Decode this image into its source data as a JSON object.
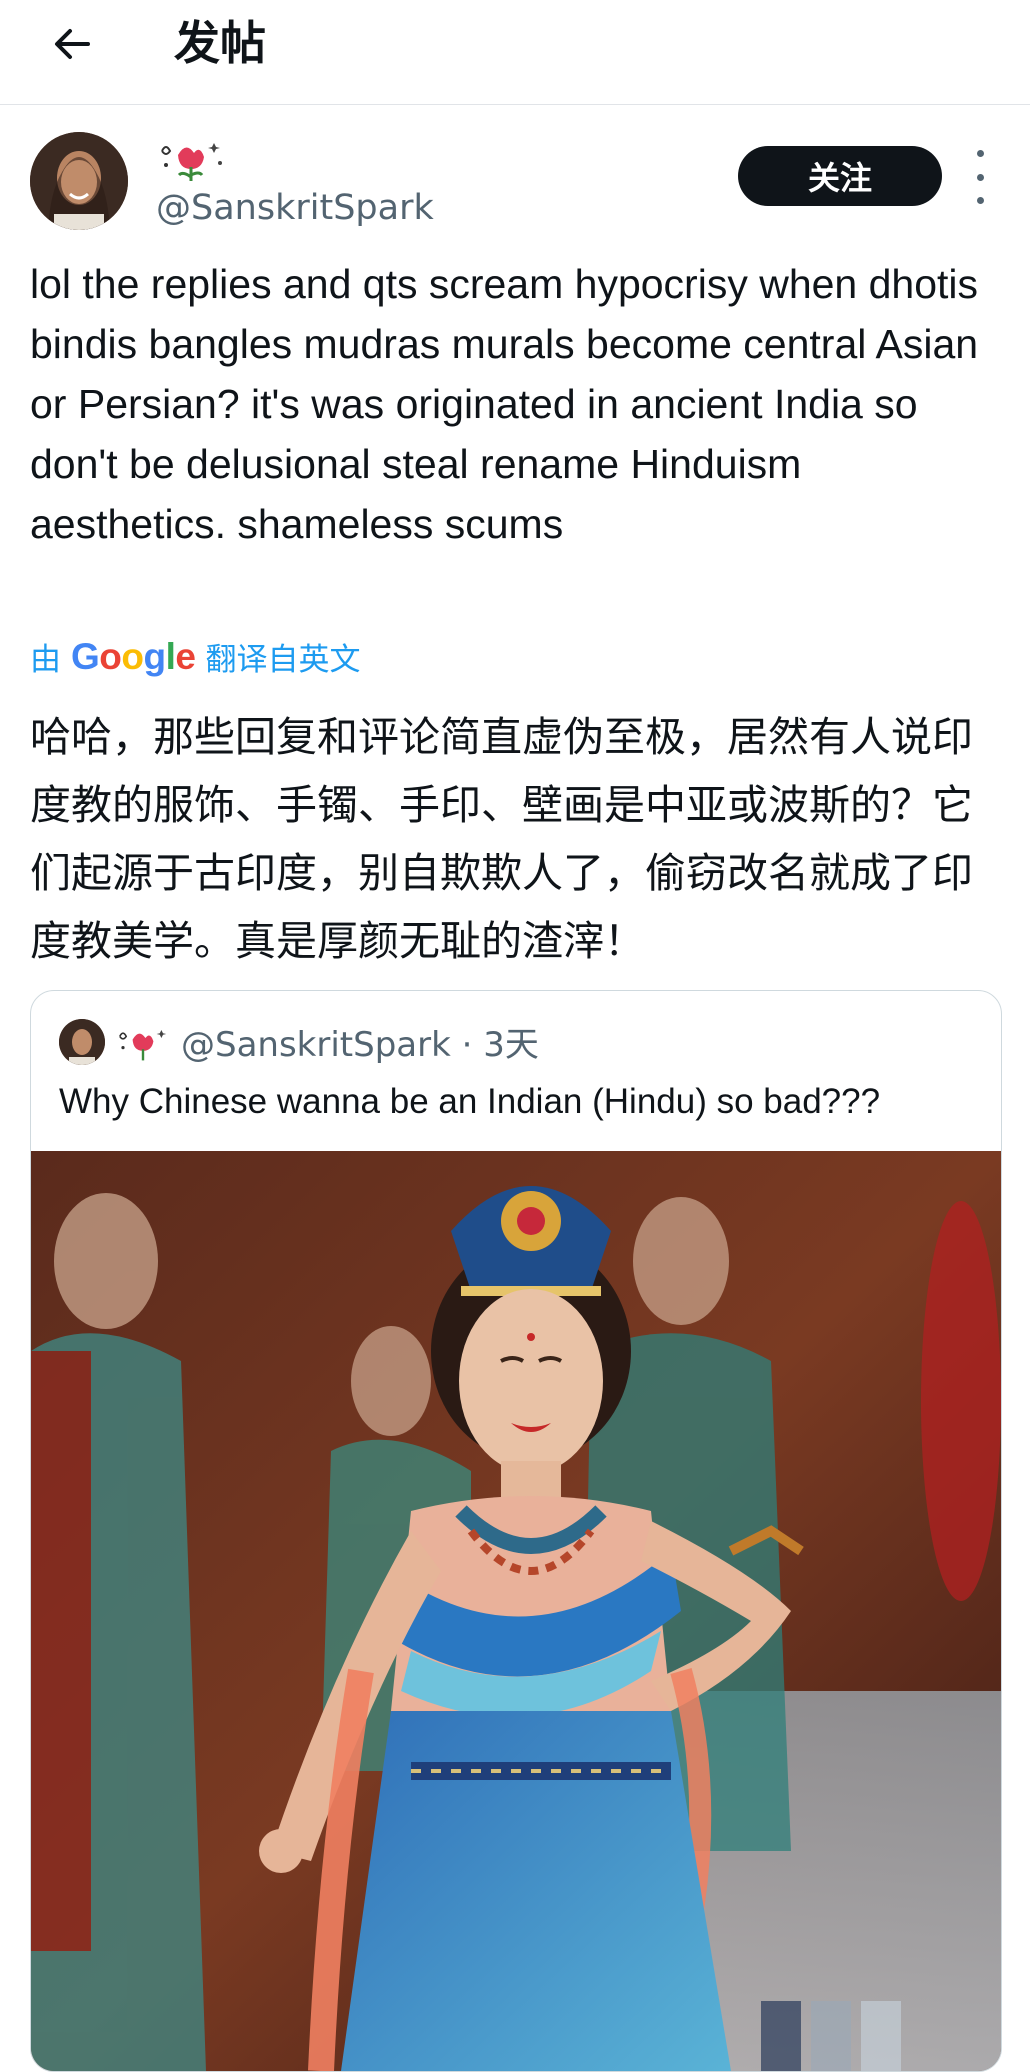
{
  "header": {
    "title": "发帖",
    "back_icon": "arrow-left-icon"
  },
  "author": {
    "handle": "@SanskritSpark",
    "follow_label": "关注"
  },
  "post": {
    "text_en": "lol the replies and qts scream hypocrisy when dhotis bindis bangles mudras murals become central Asian or Persian? it's was originated in ancient India so don't be delusional steal rename Hinduism aesthetics. shameless scums",
    "translation": {
      "prefix": "由",
      "brand": "Google",
      "suffix": "翻译自英文"
    },
    "text_zh": "哈哈，那些回复和评论简直虚伪至极，居然有人说印度教的服饰、手镯、手印、壁画是中亚或波斯的？它们起源于古印度，别自欺欺人了，偷窃改名就成了印度教美学。真是厚颜无耻的渣滓！"
  },
  "quoted": {
    "handle": "@SanskritSpark",
    "separator": " · ",
    "time": "3天",
    "text": "Why Chinese wanna be an Indian (Hindu) so bad???"
  },
  "colors": {
    "link_blue": "#1d9bf0",
    "text": "#0f1419",
    "muted": "#536471",
    "border": "#cfd9de"
  }
}
